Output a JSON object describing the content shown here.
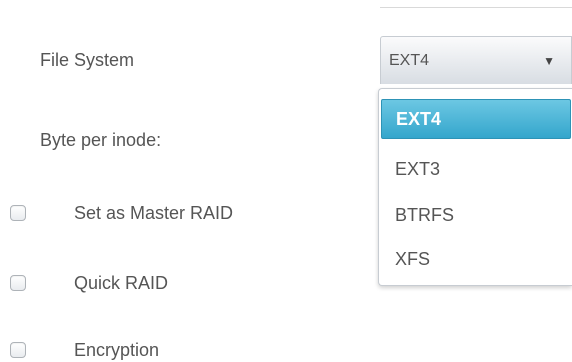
{
  "form": {
    "file_system_label": "File System",
    "byte_per_inode_label": "Byte per inode:",
    "options": {
      "master_raid_label": "Set as Master RAID",
      "quick_raid_label": "Quick RAID",
      "encryption_label": "Encryption"
    }
  },
  "file_system_select": {
    "selected_value": "EXT4",
    "arrow_icon": "dropdown-arrow-icon",
    "options": [
      {
        "label": "EXT4",
        "selected": true
      },
      {
        "label": "EXT3",
        "selected": false
      },
      {
        "label": "BTRFS",
        "selected": false
      },
      {
        "label": "XFS",
        "selected": false
      }
    ]
  },
  "colors": {
    "highlight": "#3fb0d6",
    "text": "#555555",
    "border": "#c7ccd2"
  }
}
